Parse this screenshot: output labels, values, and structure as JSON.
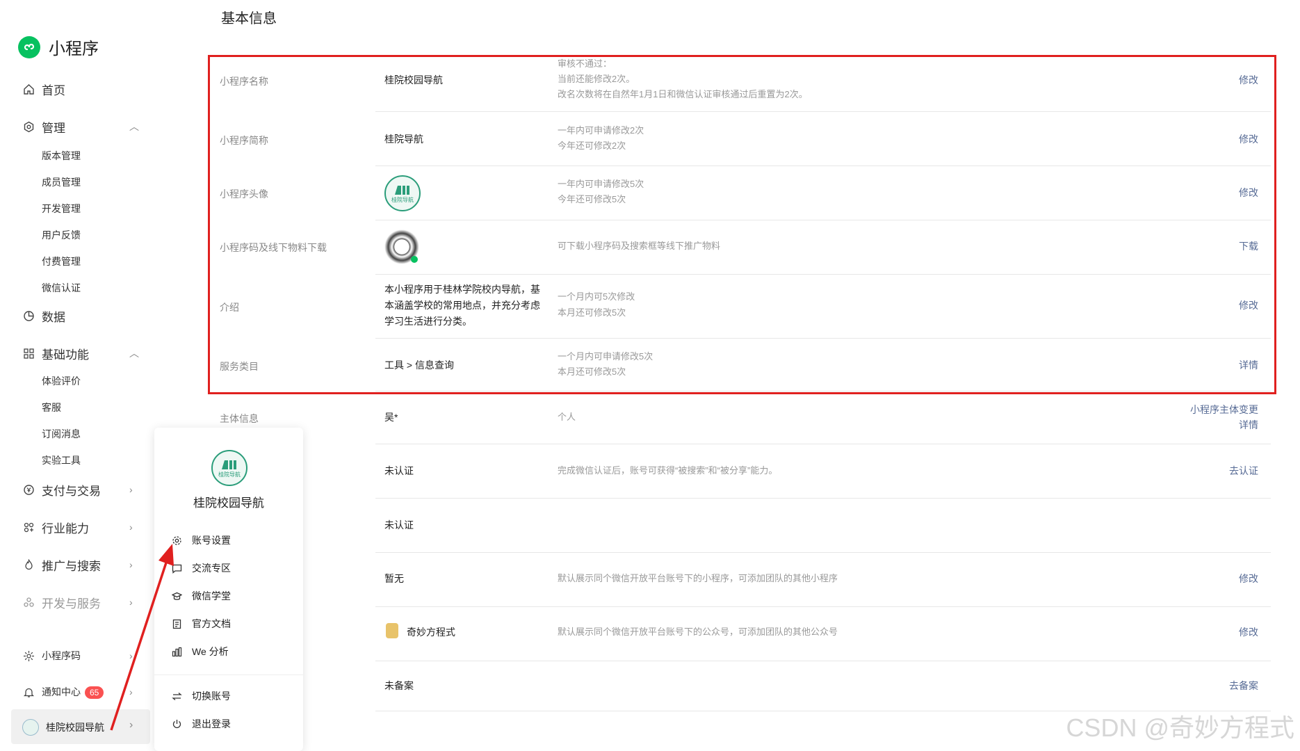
{
  "brand": {
    "name": "小程序",
    "color": "#07c160"
  },
  "sidebar": {
    "home": "首页",
    "manage": {
      "label": "管理",
      "items": [
        "版本管理",
        "成员管理",
        "开发管理",
        "用户反馈",
        "付费管理",
        "微信认证"
      ]
    },
    "data": "数据",
    "basic": {
      "label": "基础功能",
      "items": [
        "体验评价",
        "客服",
        "订阅消息",
        "实验工具"
      ]
    },
    "pay": "支付与交易",
    "industry": "行业能力",
    "promo": "推广与搜索",
    "devsvc": "开发与服务",
    "qrcode": "小程序码",
    "notify": {
      "label": "通知中心",
      "badge": "65"
    },
    "account": "桂院校园导航"
  },
  "main": {
    "title": "基本信息",
    "rows": [
      {
        "key": "小程序名称",
        "value": "桂院校园导航",
        "desc1": "审核不通过：",
        "desc2": "当前还能修改2次。",
        "desc3": "改名次数将在自然年1月1日和微信认证审核通过后重置为2次。",
        "action": "修改"
      },
      {
        "key": "小程序简称",
        "value": "桂院导航",
        "desc1": "一年内可申请修改2次",
        "desc2": "今年还可修改2次",
        "action": "修改"
      },
      {
        "key": "小程序头像",
        "avatar_text": "桂院导航",
        "desc1": "一年内可申请修改5次",
        "desc2": "今年还可修改5次",
        "action": "修改"
      },
      {
        "key": "小程序码及线下物料下载",
        "desc1": "可下载小程序码及搜索框等线下推广物料",
        "action": "下载"
      },
      {
        "key": "介绍",
        "value1": "本小程序用于桂林学院校内导航，基",
        "value2": "本涵盖学校的常用地点，并充分考虑",
        "value3": "学习生活进行分类。",
        "desc1": "一个月内可5次修改",
        "desc2": "本月还可修改5次",
        "action": "修改"
      },
      {
        "key": "服务类目",
        "value": "工具 > 信息查询",
        "desc1": "一个月内可申请修改5次",
        "desc2": "本月还可修改5次",
        "action": "详情"
      },
      {
        "key": "主体信息",
        "value": "吴*",
        "desc1": "个人",
        "action1": "小程序主体变更",
        "action2": "详情"
      },
      {
        "value": "未认证",
        "desc1": "完成微信认证后，账号可获得“被搜索”和“被分享”能力。",
        "action": "去认证"
      },
      {
        "value": "未认证"
      },
      {
        "value": "暂无",
        "desc1": "默认展示同个微信开放平台账号下的小程序，可添加团队的其他小程序",
        "action": "修改"
      },
      {
        "value": "奇妙方程式",
        "desc1": "默认展示同个微信开放平台账号下的公众号，可添加团队的其他公众号",
        "action": "修改"
      },
      {
        "value": "未备案",
        "action": "去备案"
      }
    ]
  },
  "popover": {
    "avatar_text": "桂院导航",
    "name": "桂院校园导航",
    "items": [
      "账号设置",
      "交流专区",
      "微信学堂",
      "官方文档",
      "We 分析"
    ],
    "items2": [
      "切换账号",
      "退出登录"
    ]
  },
  "annotation_color": "#e0201f",
  "watermark": "CSDN @奇妙方程式"
}
